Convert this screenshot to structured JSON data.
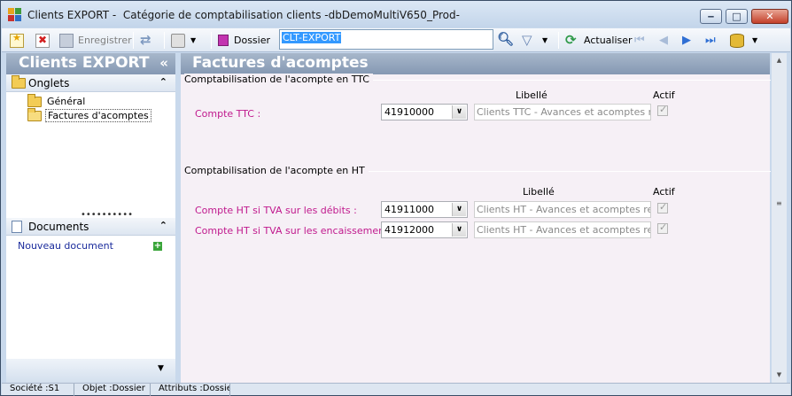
{
  "window": {
    "title": "Clients EXPORT -  Catégorie de comptabilisation clients -dbDemoMultiV650_Prod-"
  },
  "toolbar": {
    "save_label": "Enregistrer",
    "folder_label": "Dossier",
    "search_value": "CLT-EXPORT",
    "refresh_label": "Actualiser"
  },
  "left_pane": {
    "title": "Clients EXPORT",
    "collapse_glyph": "«",
    "tabs_section": "Onglets",
    "tabs": [
      {
        "label": "Général"
      },
      {
        "label": "Factures d'acomptes"
      }
    ],
    "documents_section": "Documents",
    "new_document": "Nouveau document"
  },
  "main": {
    "title": "Factures d'acomptes",
    "group_ttc": {
      "title": "Comptabilisation de l'acompte en TTC",
      "col_libelle": "Libellé",
      "col_actif": "Actif",
      "rows": [
        {
          "label": "Compte TTC  :",
          "code": "41910000",
          "libelle": "Clients TTC - Avances et acomptes reçus",
          "actif": true
        }
      ]
    },
    "group_ht": {
      "title": "Comptabilisation de l'acompte en HT",
      "col_libelle": "Libellé",
      "col_actif": "Actif",
      "rows": [
        {
          "label": "Compte HT si TVA sur les débits :",
          "code": "41911000",
          "libelle": "Clients HT - Avances et acomptes reçus s",
          "actif": true
        },
        {
          "label": "Compte HT si TVA sur les encaissements :",
          "code": "41912000",
          "libelle": "Clients HT - Avances et acomptes reçus s",
          "actif": true
        }
      ]
    }
  },
  "status_bar": {
    "societe": "Société :S1",
    "objet": "Objet :Dossier",
    "attributs": "Attributs :Dossier"
  }
}
